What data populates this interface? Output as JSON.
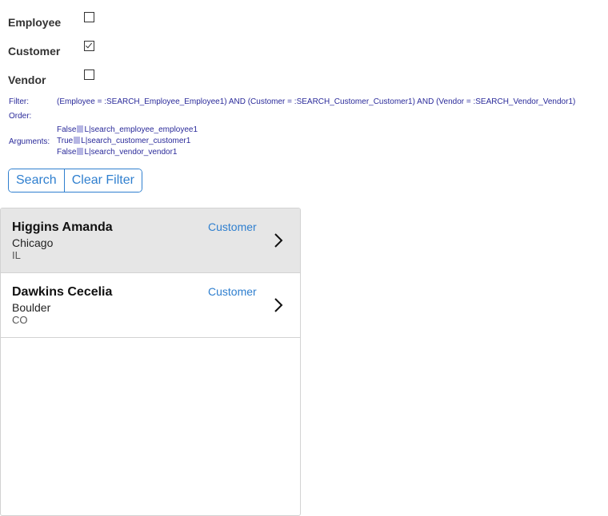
{
  "filters": [
    {
      "label": "Employee",
      "checked": false
    },
    {
      "label": "Customer",
      "checked": true
    },
    {
      "label": "Vendor",
      "checked": false
    }
  ],
  "debug": {
    "filter_label": "Filter:",
    "filter_value": "(Employee = :SEARCH_Employee_Employee1) AND (Customer = :SEARCH_Customer_Customer1) AND (Vendor = :SEARCH_Vendor_Vendor1)",
    "order_label": "Order:",
    "arguments_label": "Arguments:",
    "arguments": [
      {
        "value": "False",
        "type": "L",
        "name": "search_employee_employee1"
      },
      {
        "value": "True",
        "type": "L",
        "name": "search_customer_customer1"
      },
      {
        "value": "False",
        "type": "L",
        "name": "search_vendor_vendor1"
      }
    ]
  },
  "buttons": {
    "search": "Search",
    "clear": "Clear Filter"
  },
  "results": [
    {
      "name": "Higgins Amanda",
      "city": "Chicago",
      "state": "IL",
      "type": "Customer",
      "selected": true
    },
    {
      "name": "Dawkins Cecelia",
      "city": "Boulder",
      "state": "CO",
      "type": "Customer",
      "selected": false
    }
  ]
}
